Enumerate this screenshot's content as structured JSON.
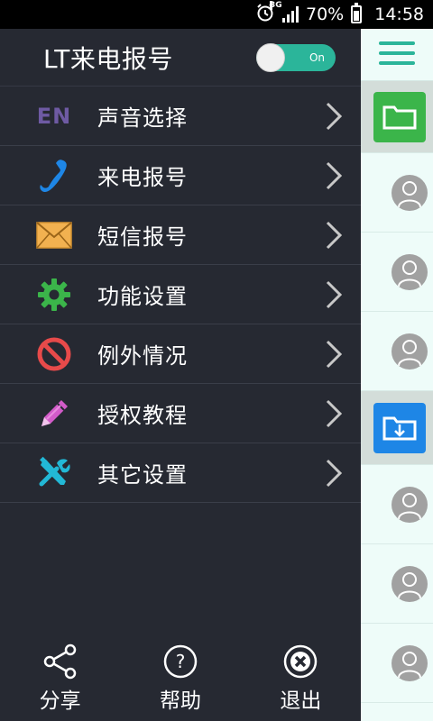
{
  "status_bar": {
    "network": "3G",
    "battery_percent": "70%",
    "time": "14:58",
    "icons": [
      "alarm-icon",
      "signal-icon",
      "battery-icon"
    ]
  },
  "header": {
    "title": "LT来电报号",
    "toggle_label": "On",
    "toggle_on": true,
    "accent_color": "#2bb59a"
  },
  "menu": {
    "items": [
      {
        "label": "声音选择",
        "icon": "en-text-icon",
        "icon_text": "EN",
        "color": "#6e5aa3"
      },
      {
        "label": "来电报号",
        "icon": "phone-icon",
        "color": "#1e86e6"
      },
      {
        "label": "短信报号",
        "icon": "envelope-icon",
        "color": "#f2b150"
      },
      {
        "label": "功能设置",
        "icon": "gear-icon",
        "color": "#3bb54a"
      },
      {
        "label": "例外情况",
        "icon": "prohibited-icon",
        "color": "#e74a4a"
      },
      {
        "label": "授权教程",
        "icon": "pencil-icon",
        "color": "#d25bc9"
      },
      {
        "label": "其它设置",
        "icon": "tools-icon",
        "color": "#22b8d6"
      }
    ]
  },
  "bottom_bar": {
    "share": "分享",
    "help": "帮助",
    "exit": "退出"
  },
  "content_peek": {
    "folder_colors": [
      "#3bb54a",
      "#1e86e6"
    ]
  }
}
